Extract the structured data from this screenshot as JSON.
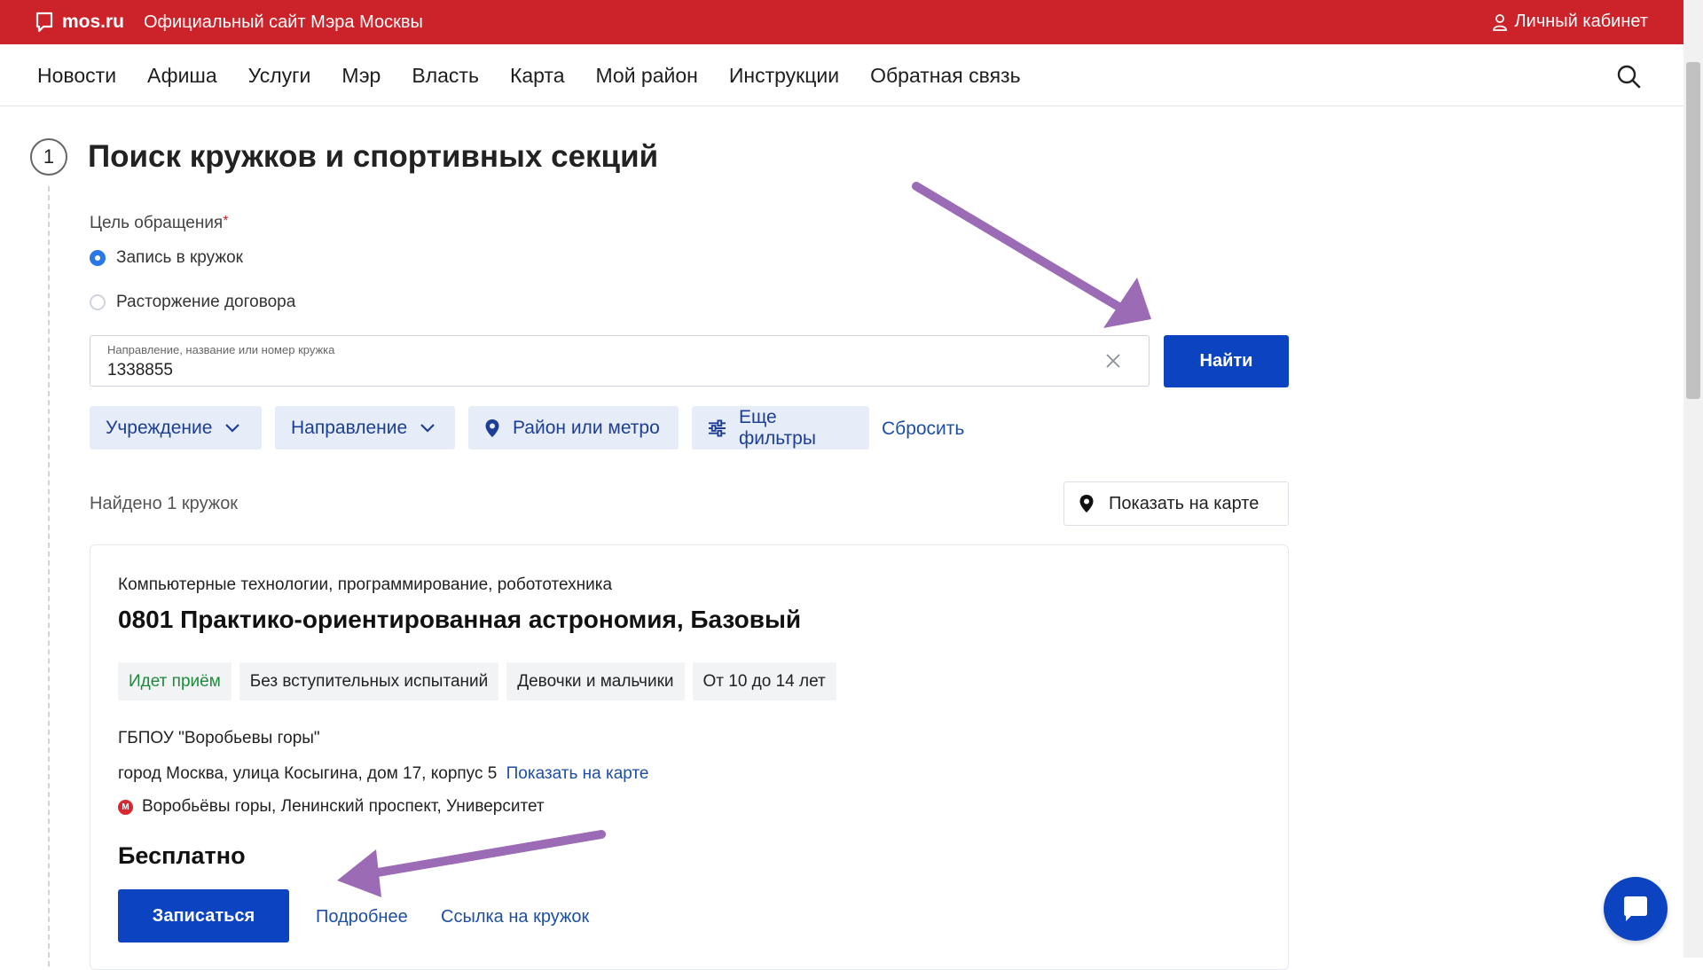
{
  "header": {
    "logo_text": "mos.ru",
    "site_title": "Официальный сайт Мэра Москвы",
    "cabinet_label": "Личный кабинет",
    "bg_color": "#cc2229"
  },
  "nav": {
    "items": [
      "Новости",
      "Афиша",
      "Услуги",
      "Мэр",
      "Власть",
      "Карта",
      "Мой район",
      "Инструкции",
      "Обратная связь"
    ],
    "search_icon": "search-icon"
  },
  "step": {
    "number": "1",
    "title": "Поиск кружков и спортивных секций"
  },
  "goal": {
    "label": "Цель обращения",
    "required_mark": "*",
    "options": [
      {
        "label": "Запись в кружок",
        "selected": true
      },
      {
        "label": "Расторжение договора",
        "selected": false
      }
    ]
  },
  "search": {
    "label": "Направление, название или номер кружка",
    "value": "1338855",
    "button": "Найти"
  },
  "filters": {
    "chips": [
      "Учреждение",
      "Направление",
      "Район или метро",
      "Еще фильтры"
    ],
    "reset": "Сбросить"
  },
  "results": {
    "found_text": "Найдено 1 кружок",
    "map_button": "Показать на карте"
  },
  "card": {
    "category": "Компьютерные технологии, программирование, робототехника",
    "title": "0801 Практико-ориентированная астрономия, Базовый",
    "tags": [
      "Идет приём",
      "Без вступительных испытаний",
      "Девочки и мальчики",
      "От 10 до 14 лет"
    ],
    "organization": "ГБПОУ \"Воробьевы горы\"",
    "address": "город Москва, улица Косыгина, дом 17, корпус 5",
    "address_map_link": "Показать на карте",
    "metro_icon_letter": "М",
    "metro": "Воробьёвы горы, Ленинский проспект, Университет",
    "price": "Бесплатно",
    "enroll_button": "Записаться",
    "details_link": "Подробнее",
    "club_link": "Ссылка на кружок"
  },
  "colors": {
    "primary_button": "#0b43c1",
    "link": "#1d4fa3",
    "chip_bg": "#e7edf8",
    "status_green": "#1f8a3d",
    "annotation_arrow": "#9b6bb5"
  }
}
